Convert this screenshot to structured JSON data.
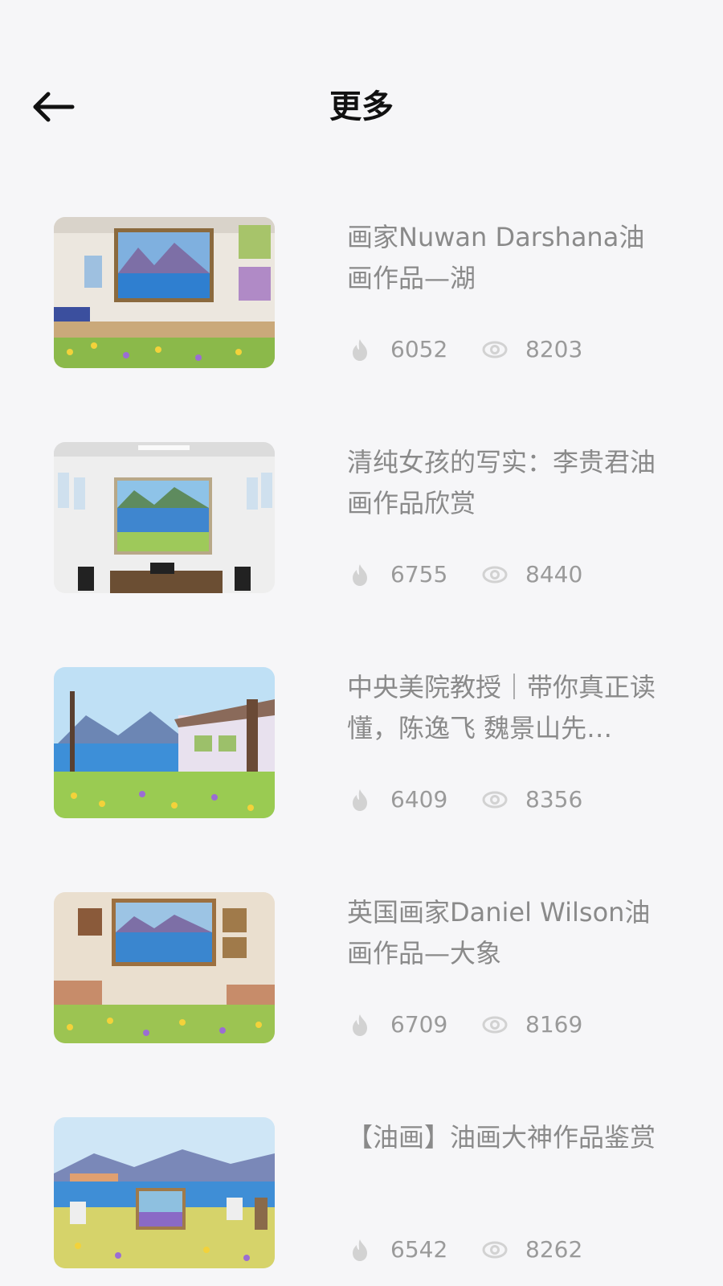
{
  "header": {
    "title": "更多",
    "back_icon": "arrow-left-icon"
  },
  "items": [
    {
      "title": "画家Nuwan Darshana油画作品—湖",
      "likes": "6052",
      "views": "8203",
      "thumb_caption": "油画作品展示"
    },
    {
      "title": "清纯女孩的写实：李贵君油画作品欣赏",
      "likes": "6755",
      "views": "8440",
      "thumb_caption": "油画作品展示"
    },
    {
      "title": "中央美院教授｜带你真正读懂，陈逸飞 魏景山先…",
      "likes": "6409",
      "views": "8356",
      "thumb_caption": "油画作品展示"
    },
    {
      "title": "英国画家Daniel Wilson油画作品—大象",
      "likes": "6709",
      "views": "8169",
      "thumb_caption": "油画作品展示"
    },
    {
      "title": "【油画】油画大神作品鉴赏",
      "likes": "6542",
      "views": "8262",
      "thumb_caption": "油画作品展示"
    }
  ],
  "icons": {
    "likes": "flame-icon",
    "views": "eye-icon"
  },
  "colors": {
    "background": "#f6f6f8",
    "title_text": "#111111",
    "item_text": "#8a8a8a",
    "stat_text": "#9a9a9a",
    "icon": "#cfcfcf"
  }
}
